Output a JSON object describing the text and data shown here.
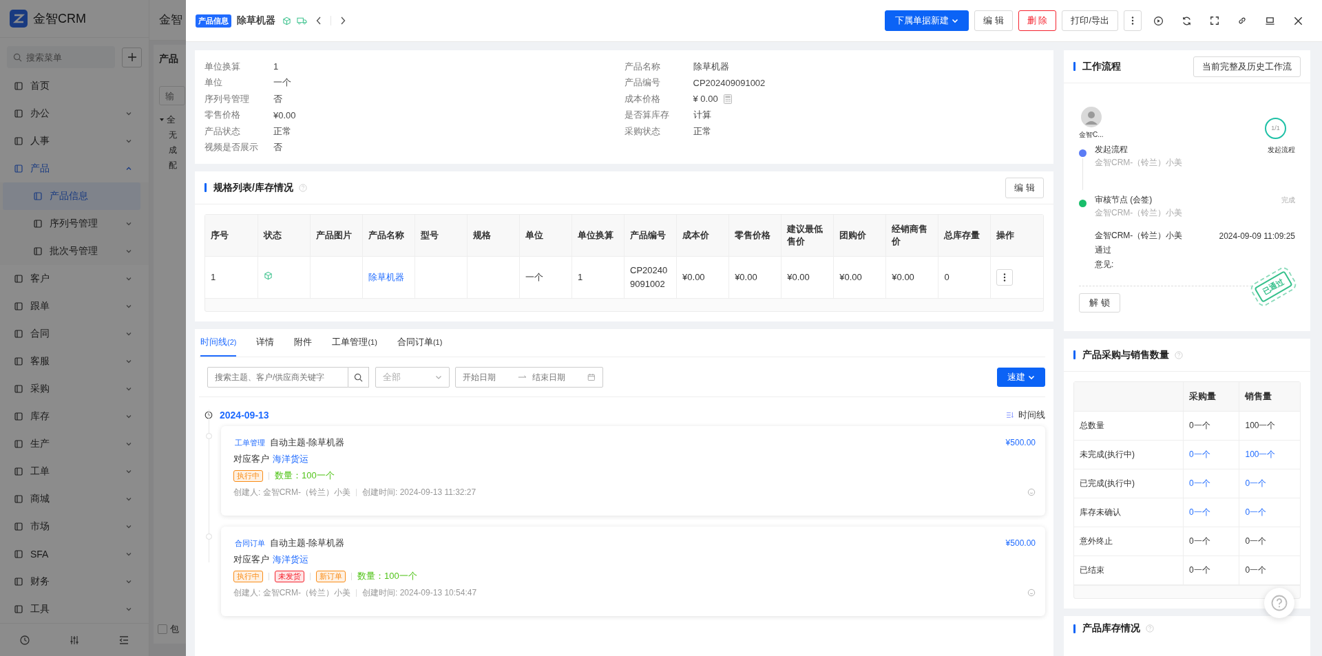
{
  "sidebar": {
    "logo": "金智CRM",
    "search_placeholder": "搜索菜单",
    "items": [
      {
        "label": "首页",
        "kind": "link",
        "selected": false
      },
      {
        "label": "办公",
        "kind": "group",
        "expanded": false,
        "selected": false
      },
      {
        "label": "人事",
        "kind": "group",
        "expanded": false,
        "selected": false
      },
      {
        "label": "产品",
        "kind": "group",
        "expanded": true,
        "selected": false,
        "children": [
          {
            "label": "产品信息",
            "kind": "link",
            "selected": true
          },
          {
            "label": "序列号管理",
            "kind": "group",
            "expanded": false,
            "selected": false
          },
          {
            "label": "批次号管理",
            "kind": "group",
            "expanded": false,
            "selected": false
          }
        ]
      },
      {
        "label": "客户",
        "kind": "group",
        "expanded": false,
        "selected": false
      },
      {
        "label": "跟单",
        "kind": "group",
        "expanded": false,
        "selected": false
      },
      {
        "label": "合同",
        "kind": "group",
        "expanded": false,
        "selected": false
      },
      {
        "label": "客服",
        "kind": "group",
        "expanded": false,
        "selected": false
      },
      {
        "label": "采购",
        "kind": "group",
        "expanded": false,
        "selected": false
      },
      {
        "label": "库存",
        "kind": "group",
        "expanded": false,
        "selected": false
      },
      {
        "label": "生产",
        "kind": "group",
        "expanded": false,
        "selected": false
      },
      {
        "label": "工单",
        "kind": "group",
        "expanded": false,
        "selected": false
      },
      {
        "label": "商城",
        "kind": "group",
        "expanded": false,
        "selected": false
      },
      {
        "label": "市场",
        "kind": "group",
        "expanded": false,
        "selected": false
      },
      {
        "label": "SFA",
        "kind": "group",
        "expanded": false,
        "selected": false
      },
      {
        "label": "财务",
        "kind": "group",
        "expanded": false,
        "selected": false
      },
      {
        "label": "工具",
        "kind": "group",
        "expanded": false,
        "selected": false
      }
    ]
  },
  "background": {
    "header_title": "金智",
    "panel_title": "产品",
    "input_placeholder": "输",
    "tree": {
      "label": "全",
      "expanded": true,
      "children": [
        "无",
        "成",
        "配"
      ]
    },
    "checkbox": {
      "label": "包",
      "checked": false
    }
  },
  "drawer": {
    "badge": "产品信息",
    "title": "除草机器",
    "actions": [
      {
        "label": "下属单据新建",
        "kind": "primary",
        "dropdown": true
      },
      {
        "label": "编 辑",
        "kind": "default",
        "dropdown": false
      },
      {
        "label": "删 除",
        "kind": "danger",
        "dropdown": false
      },
      {
        "label": "打印/导出",
        "kind": "default",
        "dropdown": false
      }
    ],
    "info": {
      "left": [
        {
          "label": "单位换算",
          "value": "1"
        },
        {
          "label": "单位",
          "value": "一个"
        },
        {
          "label": "序列号管理",
          "value": "否"
        },
        {
          "label": "零售价格",
          "value": "¥0.00"
        },
        {
          "label": "产品状态",
          "value": "正常"
        },
        {
          "label": "视频是否展示",
          "value": "否"
        }
      ],
      "right": [
        {
          "label": "产品名称",
          "value": "除草机器",
          "calculator": false
        },
        {
          "label": "产品编号",
          "value": "CP202409091002",
          "calculator": false
        },
        {
          "label": "成本价格",
          "value": "¥ 0.00",
          "calculator": true
        },
        {
          "label": "是否算库存",
          "value": "计算",
          "calculator": false
        },
        {
          "label": "采购状态",
          "value": "正常",
          "calculator": false
        }
      ]
    },
    "specs": {
      "title": "规格列表/库存情况",
      "edit_button": "编 辑",
      "columns": [
        "序号",
        "状态",
        "产品图片",
        "产品名称",
        "型号",
        "规格",
        "单位",
        "单位换算",
        "产品编号",
        "成本价",
        "零售价格",
        "建议最低售价",
        "团购价",
        "经销商售价",
        "总库存量",
        "操作"
      ],
      "rows": [
        {
          "cells": [
            {
              "kind": "text",
              "text": "1"
            },
            {
              "kind": "status"
            },
            {
              "kind": "empty"
            },
            {
              "kind": "link",
              "text": "除草机器"
            },
            {
              "kind": "empty"
            },
            {
              "kind": "empty"
            },
            {
              "kind": "text",
              "text": "一个"
            },
            {
              "kind": "text",
              "text": "1"
            },
            {
              "kind": "text",
              "text": "CP202409091002"
            },
            {
              "kind": "text",
              "text": "¥0.00"
            },
            {
              "kind": "text",
              "text": "¥0.00"
            },
            {
              "kind": "text",
              "text": "¥0.00"
            },
            {
              "kind": "text",
              "text": "¥0.00"
            },
            {
              "kind": "text",
              "text": "¥0.00"
            },
            {
              "kind": "text",
              "text": "0"
            },
            {
              "kind": "action"
            }
          ]
        }
      ]
    },
    "tabs": [
      {
        "label": "时间线",
        "count": "(2)",
        "selected": true
      },
      {
        "label": "详情",
        "selected": false
      },
      {
        "label": "附件",
        "selected": false
      },
      {
        "label": "工单管理",
        "count": "(1)",
        "selected": false
      },
      {
        "label": "合同订单",
        "count": "(1)",
        "selected": false
      }
    ],
    "filter": {
      "search_placeholder": "搜索主题、客户/供应商关键字",
      "type_value": "全部",
      "start_placeholder": "开始日期",
      "end_placeholder": "结束日期",
      "quick_button": "速建"
    },
    "timeline": {
      "date": "2024-09-13",
      "view_label": "时间线",
      "entries": [
        {
          "type": "工单管理",
          "title": "自动主题-除草机器",
          "amount": "¥500.00",
          "customer_label": "对应客户",
          "customer": "海洋货运",
          "tags": [
            {
              "text": "执行中",
              "color": "#fa8c16"
            }
          ],
          "quantity": "数量：100一个",
          "creator": "创建人: 金智CRM-（铃兰）小美",
          "created": "创建时间: 2024-09-13 11:32:27"
        },
        {
          "type": "合同订单",
          "title": "自动主题-除草机器",
          "amount": "¥500.00",
          "customer_label": "对应客户",
          "customer": "海洋货运",
          "tags": [
            {
              "text": "执行中",
              "color": "#fa8c16"
            },
            {
              "text": "未发货",
              "color": "#f5222d"
            },
            {
              "text": "新订单",
              "color": "#fa8c16"
            }
          ],
          "quantity": "数量：100一个",
          "creator": "创建人: 金智CRM-（铃兰）小美",
          "created": "创建时间: 2024-09-13 10:54:47"
        }
      ]
    },
    "workflow": {
      "title": "工作流程",
      "history_button": "当前完整及历史工作流",
      "initiator": "金智C...",
      "progress": "1/1",
      "steps": [
        {
          "title": "发起流程",
          "person": "金智CRM-（铃兰）小美",
          "status": "发起流程",
          "color": "#5b7cf5"
        },
        {
          "title": "审核节点 (会签)",
          "person": "金智CRM-（铃兰）小美",
          "status": "完成",
          "color": "#19be6b"
        }
      ],
      "approval": {
        "person": "金智CRM-（铃兰）小美",
        "time": "2024-09-09 11:09:25",
        "result": "通过",
        "comment_label": "意见:"
      },
      "stamp": "已通过",
      "unlock_button": "解 锁"
    },
    "sales": {
      "title": "产品采购与销售数量",
      "columns": [
        "采购量",
        "销售量"
      ],
      "rows": [
        {
          "label": "总数量",
          "link": false,
          "purchase": "0一个",
          "sales": "100一个"
        },
        {
          "label": "未完成(执行中)",
          "link": true,
          "purchase": "0一个",
          "sales": "100一个"
        },
        {
          "label": "已完成(执行中)",
          "link": true,
          "purchase": "0一个",
          "sales": "0一个"
        },
        {
          "label": "库存未确认",
          "link": true,
          "purchase": "0一个",
          "sales": "0一个"
        },
        {
          "label": "意外终止",
          "link": false,
          "purchase": "0一个",
          "sales": "0一个"
        },
        {
          "label": "已结束",
          "link": false,
          "purchase": "0一个",
          "sales": "0一个"
        }
      ]
    },
    "stock": {
      "title": "产品库存情况"
    }
  }
}
